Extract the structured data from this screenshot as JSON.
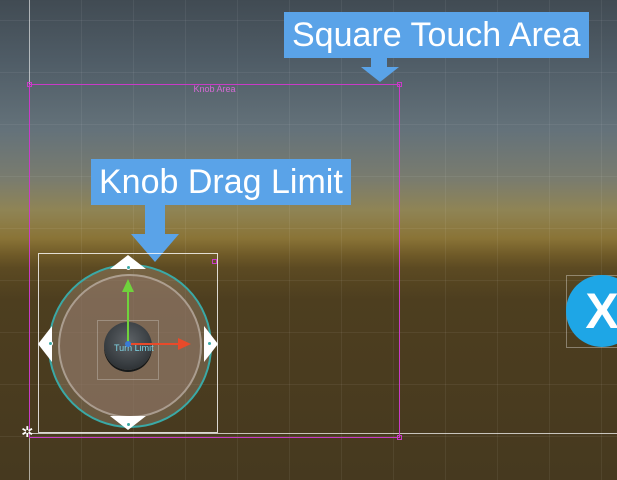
{
  "callouts": {
    "square_touch_area": "Square Touch Area",
    "knob_drag_limit": "Knob Drag Limit"
  },
  "gizmo_labels": {
    "knob_area": "Knob Area",
    "turn_limit": "Turn Limit"
  },
  "button": {
    "label": "X"
  },
  "icons": {
    "pivot": "pivot-gizmo-icon",
    "move_x": "red-arrow-icon",
    "move_y": "green-arrow-icon"
  },
  "colors": {
    "callout": "#5aa3e8",
    "knob_area_border": "#c93ac7",
    "ring": "#3aa9a6",
    "button": "#1ea6e6",
    "axis_x": "#e84a2a",
    "axis_y": "#6fd33c"
  }
}
